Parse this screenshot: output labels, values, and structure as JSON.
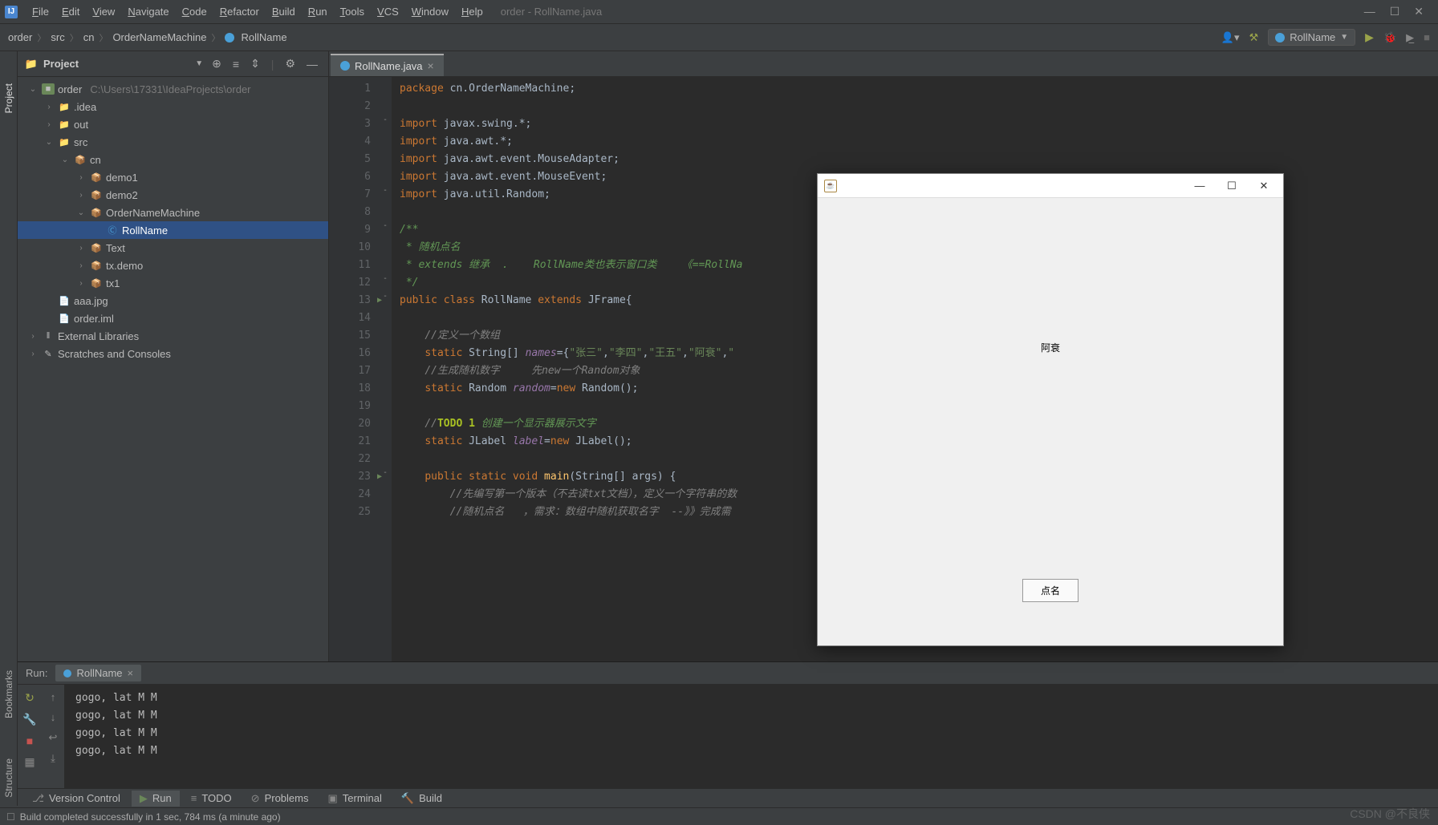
{
  "window_title": "order - RollName.java",
  "menubar": [
    "File",
    "Edit",
    "View",
    "Navigate",
    "Code",
    "Refactor",
    "Build",
    "Run",
    "Tools",
    "VCS",
    "Window",
    "Help"
  ],
  "breadcrumb": {
    "parts": [
      "order",
      "src",
      "cn",
      "OrderNameMachine",
      "RollName"
    ]
  },
  "run_config": {
    "name": "RollName"
  },
  "project_panel": {
    "title": "Project",
    "root": {
      "name": "order",
      "path": "C:\\Users\\17331\\IdeaProjects\\order"
    },
    "tree": [
      {
        "depth": 0,
        "arrow": "v",
        "icon": "module",
        "label": "order",
        "dim": "C:\\Users\\17331\\IdeaProjects\\order"
      },
      {
        "depth": 1,
        "arrow": ">",
        "icon": "folder",
        "label": ".idea"
      },
      {
        "depth": 1,
        "arrow": ">",
        "icon": "folder",
        "label": "out",
        "orange": true
      },
      {
        "depth": 1,
        "arrow": "v",
        "icon": "folder-src",
        "label": "src"
      },
      {
        "depth": 2,
        "arrow": "v",
        "icon": "pkg",
        "label": "cn"
      },
      {
        "depth": 3,
        "arrow": ">",
        "icon": "pkg",
        "label": "demo1"
      },
      {
        "depth": 3,
        "arrow": ">",
        "icon": "pkg",
        "label": "demo2"
      },
      {
        "depth": 3,
        "arrow": "v",
        "icon": "pkg",
        "label": "OrderNameMachine"
      },
      {
        "depth": 4,
        "arrow": "",
        "icon": "class",
        "label": "RollName",
        "selected": true
      },
      {
        "depth": 3,
        "arrow": ">",
        "icon": "pkg",
        "label": "Text"
      },
      {
        "depth": 3,
        "arrow": ">",
        "icon": "pkg",
        "label": "tx.demo"
      },
      {
        "depth": 3,
        "arrow": ">",
        "icon": "pkg",
        "label": "tx1"
      },
      {
        "depth": 1,
        "arrow": "",
        "icon": "file",
        "label": "aaa.jpg"
      },
      {
        "depth": 1,
        "arrow": "",
        "icon": "file",
        "label": "order.iml"
      },
      {
        "depth": 0,
        "arrow": ">",
        "icon": "lib",
        "label": "External Libraries"
      },
      {
        "depth": 0,
        "arrow": ">",
        "icon": "scratch",
        "label": "Scratches and Consoles"
      }
    ]
  },
  "editor": {
    "tab": {
      "name": "RollName.java"
    },
    "lines": [
      {
        "n": 1,
        "html": "<span class='kw'>package</span> cn.OrderNameMachine;"
      },
      {
        "n": 2,
        "html": ""
      },
      {
        "n": 3,
        "html": "<span class='kw'>import</span> javax.swing.*;",
        "fold": "-"
      },
      {
        "n": 4,
        "html": "<span class='kw'>import</span> java.awt.*;"
      },
      {
        "n": 5,
        "html": "<span class='kw'>import</span> java.awt.event.MouseAdapter;"
      },
      {
        "n": 6,
        "html": "<span class='kw'>import</span> java.awt.event.MouseEvent;"
      },
      {
        "n": 7,
        "html": "<span class='kw'>import</span> java.util.Random;",
        "fold": "-"
      },
      {
        "n": 8,
        "html": ""
      },
      {
        "n": 9,
        "html": "<span class='cmt2'>/**</span>",
        "fold": "-"
      },
      {
        "n": 10,
        "html": "<span class='cmt2'> * 随机点名</span>"
      },
      {
        "n": 11,
        "html": "<span class='cmt2'> * extends 继承  .    RollName类也表示窗口类    《==RollNa</span>"
      },
      {
        "n": 12,
        "html": "<span class='cmt2'> */</span>",
        "fold": "-"
      },
      {
        "n": 13,
        "html": "<span class='kw'>public</span> <span class='kw'>class</span> RollName <span class='kw'>extends</span> JFrame{",
        "run": true,
        "fold": "-"
      },
      {
        "n": 14,
        "html": ""
      },
      {
        "n": 15,
        "html": "    <span class='cmt'>//定义一个数组</span>"
      },
      {
        "n": 16,
        "html": "    <span class='kw'>static</span> String[] <span class='field'>names</span>={<span class='str'>\"张三\"</span>,<span class='str'>\"李四\"</span>,<span class='str'>\"王五\"</span>,<span class='str'>\"阿衰\"</span>,<span class='str'>\"</span>"
      },
      {
        "n": 17,
        "html": "    <span class='cmt'>//生成随机数字     先new一个Random对象</span>"
      },
      {
        "n": 18,
        "html": "    <span class='kw'>static</span> Random <span class='field'>random</span>=<span class='kw'>new</span> Random();"
      },
      {
        "n": 19,
        "html": ""
      },
      {
        "n": 20,
        "html": "    <span class='cmt'>//</span><span class='todo'>TODO 1</span><span class='cmt2'> 创建一个显示器展示文字</span>"
      },
      {
        "n": 21,
        "html": "    <span class='kw'>static</span> JLabel <span class='field'>label</span>=<span class='kw'>new</span> JLabel();"
      },
      {
        "n": 22,
        "html": ""
      },
      {
        "n": 23,
        "html": "    <span class='kw'>public</span> <span class='kw'>static</span> <span class='kw'>void</span> <span class='fn'>main</span>(String[] args) {",
        "run": true,
        "fold": "-"
      },
      {
        "n": 24,
        "html": "        <span class='cmt'>//先编写第一个版本（不去读txt文档），定义一个字符串的数</span>"
      },
      {
        "n": 25,
        "html": "        <span class='cmt'>//随机点名   ，需求：数组中随机获取名字  --》》完成需</span>"
      }
    ]
  },
  "run_panel": {
    "label": "Run:",
    "tab": "RollName",
    "output": [
      "gogo, lat M M",
      "gogo, lat M M",
      "gogo, lat M M",
      "gogo, lat M M"
    ]
  },
  "bottom_tabs": [
    "Version Control",
    "Run",
    "TODO",
    "Problems",
    "Terminal",
    "Build"
  ],
  "statusbar": {
    "msg": "Build completed successfully in 1 sec, 784 ms (a minute ago)"
  },
  "swing": {
    "label_text": "阿衰",
    "button_text": "点名"
  },
  "left_rail": [
    "Project",
    "Bookmarks",
    "Structure"
  ],
  "watermark": "CSDN @不良侠"
}
